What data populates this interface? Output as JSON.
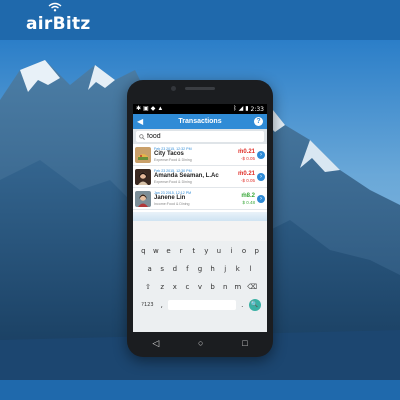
{
  "brand": {
    "logo_text": "airBitz"
  },
  "phone": {
    "status_bar": {
      "time": "2:33"
    },
    "header": {
      "title": "Transactions",
      "back_icon": "◀",
      "help_icon": "?"
    },
    "search": {
      "value": "food"
    },
    "transactions": [
      {
        "date": "Feb 23 2015, 12:32 PM",
        "name": "City Tacos",
        "category": "Expense:Food & Dining",
        "amount": "ṁ0.21",
        "fiat": "-$ 0.05",
        "direction": "out"
      },
      {
        "date": "Feb 23 2015, 12:30 PM",
        "name": "Amanda Seaman, L.Ac",
        "category": "Expense:Food & Dining",
        "amount": "ṁ0.21",
        "fiat": "-$ 0.05",
        "direction": "out"
      },
      {
        "date": "Jan 23 2015, 12:12 PM",
        "name": "Janene Lin",
        "category": "Income:Food & Dining",
        "amount": "ṁ8.2",
        "fiat": "$ 0.48",
        "direction": "in"
      }
    ],
    "keyboard": {
      "row1": [
        "q",
        "w",
        "e",
        "r",
        "t",
        "y",
        "u",
        "i",
        "o",
        "p"
      ],
      "row2": [
        "a",
        "s",
        "d",
        "f",
        "g",
        "h",
        "j",
        "k",
        "l"
      ],
      "row3": [
        "⇧",
        "z",
        "x",
        "c",
        "v",
        "b",
        "n",
        "m",
        "⌫"
      ],
      "row4": {
        "symbols": "?123",
        "comma": ",",
        "period": ".",
        "go": "🔍"
      }
    },
    "nav": {
      "back": "◁",
      "home": "○",
      "recents": "□"
    }
  },
  "colors": {
    "brand_blue": "#1f69ac",
    "header_blue": "#2f8bd6",
    "negative": "#e0312b",
    "positive": "#3aa83a",
    "go_key": "#3ab0a4"
  }
}
